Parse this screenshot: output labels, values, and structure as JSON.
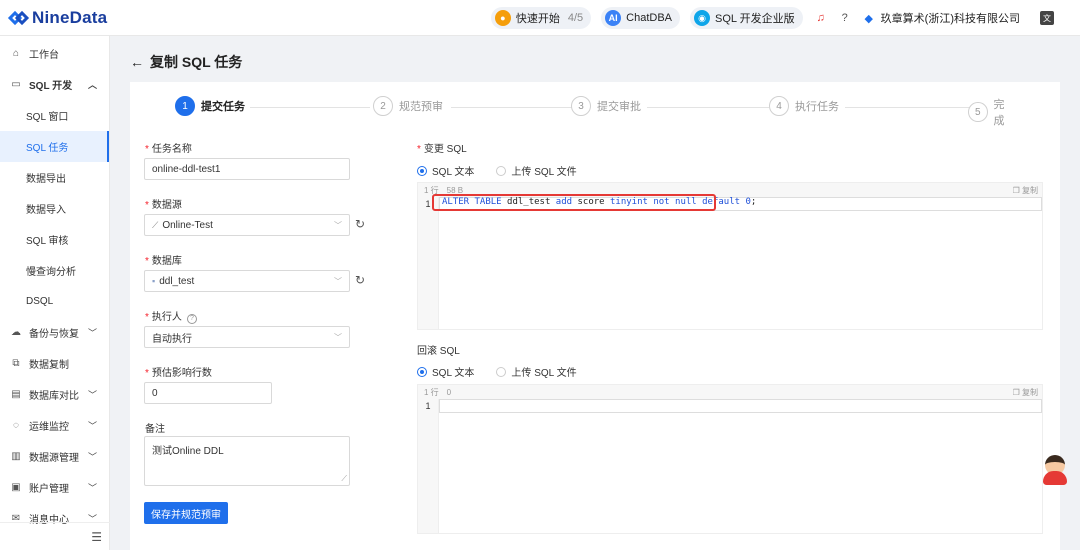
{
  "app": {
    "logo_text": "NineData",
    "quick_start_label": "快速开始",
    "quick_start_progress": "4/5",
    "chatdba_label": "ChatDBA",
    "edition_label": "SQL 开发企业版",
    "org_name": "玖章算术(浙江)科技有限公司"
  },
  "sidebar": {
    "items": [
      {
        "label": "工作台",
        "icon": "home-icon"
      },
      {
        "label": "SQL 开发",
        "icon": "sql-dev-icon"
      },
      {
        "label": "SQL 窗口"
      },
      {
        "label": "SQL 任务"
      },
      {
        "label": "数据导出"
      },
      {
        "label": "数据导入"
      },
      {
        "label": "SQL 审核"
      },
      {
        "label": "慢查询分析"
      },
      {
        "label": "DSQL"
      },
      {
        "label": "备份与恢复",
        "icon": "cloud-icon"
      },
      {
        "label": "数据复制",
        "icon": "replicate-icon"
      },
      {
        "label": "数据库对比",
        "icon": "compare-icon"
      },
      {
        "label": "运维监控",
        "icon": "monitor-icon"
      },
      {
        "label": "数据源管理",
        "icon": "datasource-icon"
      },
      {
        "label": "账户管理",
        "icon": "account-icon"
      },
      {
        "label": "消息中心",
        "icon": "mail-icon"
      }
    ]
  },
  "page": {
    "title": "复制 SQL 任务"
  },
  "steps": [
    {
      "num": "1",
      "label": "提交任务"
    },
    {
      "num": "2",
      "label": "规范预审"
    },
    {
      "num": "3",
      "label": "提交审批"
    },
    {
      "num": "4",
      "label": "执行任务"
    },
    {
      "num": "5",
      "label": "完成"
    }
  ],
  "form": {
    "task_name_label": "任务名称",
    "task_name_value": "online-ddl-test1",
    "datasource_label": "数据源",
    "datasource_value": "Online-Test",
    "database_label": "数据库",
    "database_value": "ddl_test",
    "executor_label": "执行人",
    "executor_value": "自动执行",
    "est_rows_label": "预估影响行数",
    "est_rows_value": "0",
    "remark_label": "备注",
    "remark_value": "测试Online DDL",
    "submit_label": "保存并规范预审"
  },
  "change_sql": {
    "label": "变更 SQL",
    "radio_text": "SQL 文本",
    "radio_upload": "上传 SQL 文件",
    "line_count": "1 行",
    "size": "58 B",
    "copy_label": "复制",
    "line_number": "1",
    "code_kw1": "ALTER TABLE",
    "code_t1": " ddl_test ",
    "code_kw2": "add",
    "code_t2": " score ",
    "code_kw3": "tinyint not null default",
    "code_t3": " ",
    "code_kw4": "0",
    "code_t4": ";"
  },
  "rollback_sql": {
    "label": "回滚 SQL",
    "radio_text": "SQL 文本",
    "radio_upload": "上传 SQL 文件",
    "line_count": "1 行",
    "size": "0",
    "copy_label": "复制",
    "line_number": "1"
  },
  "colors": {
    "primary": "#1f6feb",
    "highlight": "#e53935",
    "required": "#f5222d"
  }
}
